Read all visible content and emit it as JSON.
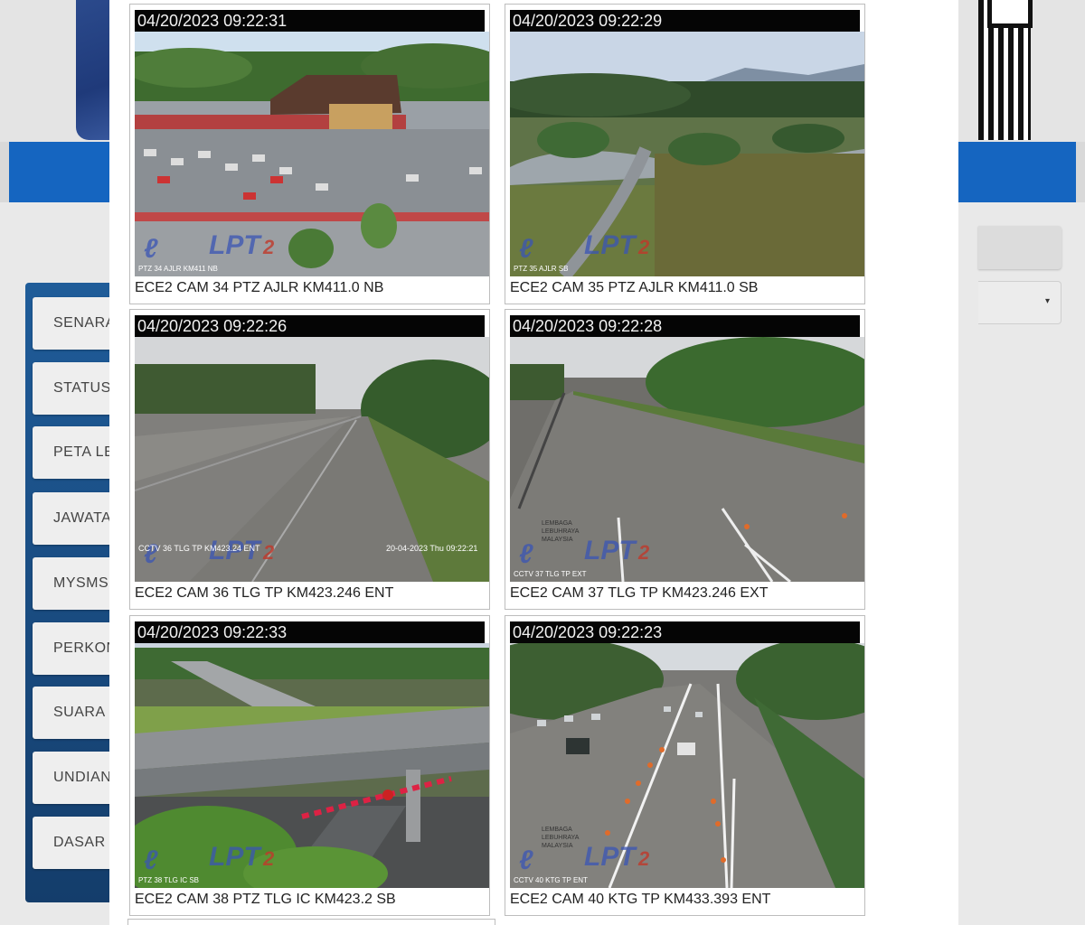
{
  "sidebar": {
    "items": [
      {
        "label": "SENARAI"
      },
      {
        "label": "STATUS"
      },
      {
        "label": "PETA LEBUHRAYA"
      },
      {
        "label": "JAWATAN"
      },
      {
        "label": "MYSMS"
      },
      {
        "label": "PERKONGSIAN"
      },
      {
        "label": "SUARA"
      },
      {
        "label": "UNDIAN"
      },
      {
        "label": "DASAR"
      }
    ]
  },
  "cameras": [
    {
      "timestamp": "04/20/2023 09:22:31",
      "caption": "ECE2 CAM 34 PTZ AJLR KM411.0 NB",
      "overlay": "PTZ 34 AJLR KM411 NB",
      "logo": "LPT2",
      "scene": "rest-area"
    },
    {
      "timestamp": "04/20/2023 09:22:29",
      "caption": "ECE2 CAM 35 PTZ AJLR KM411.0 SB",
      "overlay": "PTZ 35 AJLR SB",
      "logo": "LPT2",
      "scene": "park"
    },
    {
      "timestamp": "04/20/2023 09:22:26",
      "caption": "ECE2 CAM 36 TLG TP KM423.246 ENT",
      "overlay": "CCTV 36 TLG TP KM423.24 ENT",
      "overlay_right": "20-04-2023 Thu 09:22:21",
      "logo": "LPT2",
      "scene": "highway"
    },
    {
      "timestamp": "04/20/2023 09:22:28",
      "caption": "ECE2 CAM 37 TLG TP KM423.246 EXT",
      "overlay": "CCTV 37 TLG TP EXT",
      "watermark": "LEMBAGA LEBUHRAYA MALAYSIA",
      "logo": "LPT2",
      "scene": "highway-wide"
    },
    {
      "timestamp": "04/20/2023 09:22:33",
      "caption": "ECE2 CAM 38 PTZ TLG IC KM423.2 SB",
      "overlay": "PTZ 38 TLG IC SB",
      "logo": "LPT2",
      "scene": "bridge"
    },
    {
      "timestamp": "04/20/2023 09:22:23",
      "caption": "ECE2 CAM 40 KTG TP KM433.393 ENT",
      "overlay": "CCTV 40 KTG TP ENT",
      "watermark": "LEMBAGA LEBUHRAYA MALAYSIA",
      "logo": "LPT2",
      "scene": "toll-traffic"
    }
  ]
}
